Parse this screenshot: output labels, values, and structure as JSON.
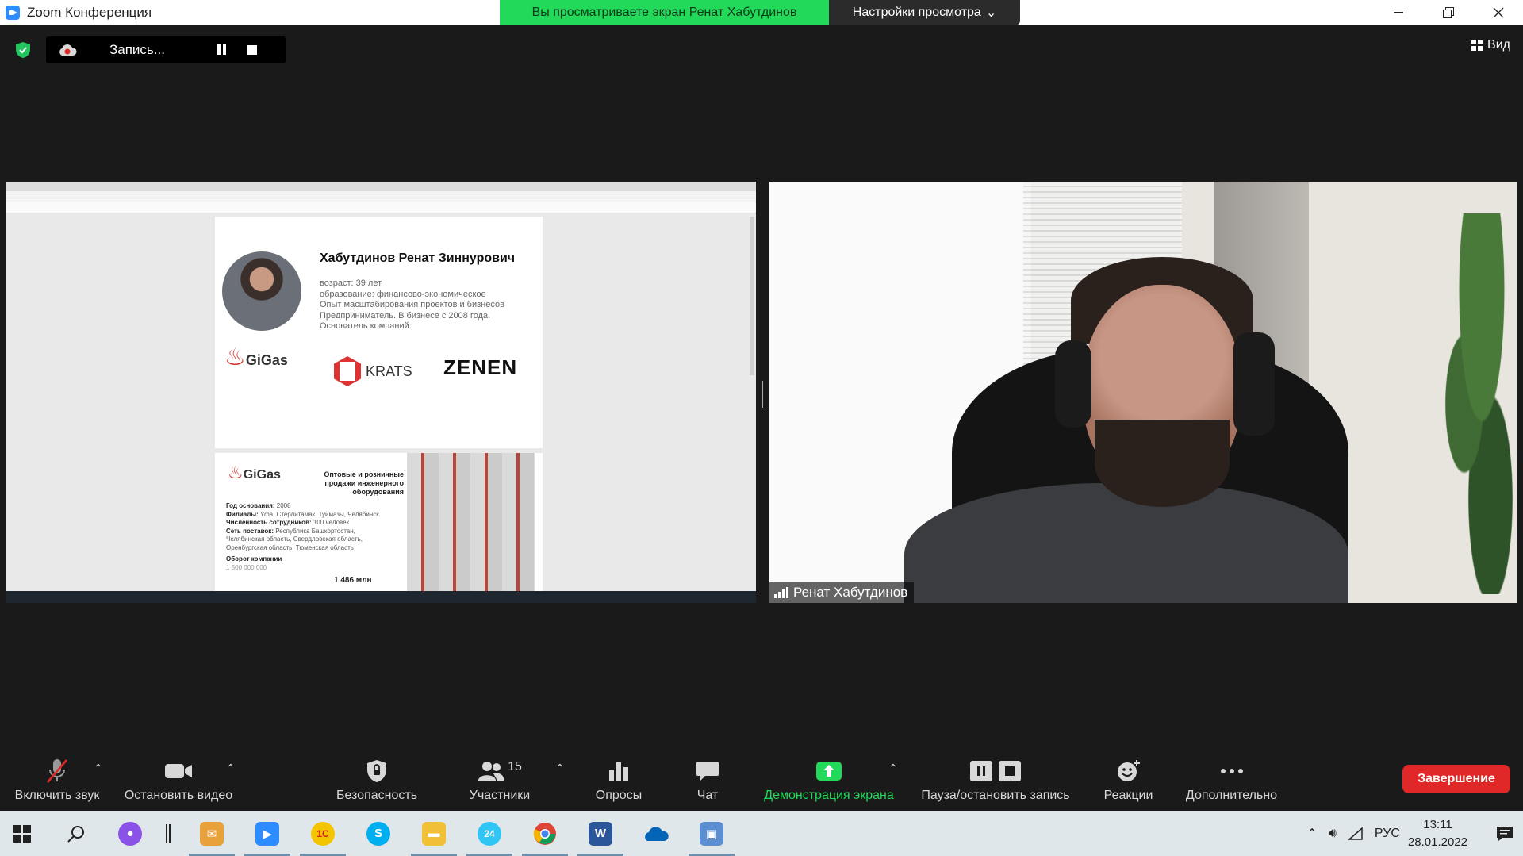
{
  "window": {
    "title": "Zoom Конференция",
    "share_banner": "Вы просматриваете экран Ренат Хабутдинов",
    "view_settings": "Настройки просмотра"
  },
  "recording": {
    "label": "Запись..."
  },
  "view_button": {
    "label": "Вид"
  },
  "shared_screen": {
    "person_name": "Хабутдинов Ренат Зиннурович",
    "person_info": [
      "возраст: 39 лет",
      "образование: финансово-экономическое",
      "Опыт масштабирования проектов и бизнесов",
      "Предприниматель. В бизнесе с 2008 года.",
      "Основатель компаний:"
    ],
    "logos": [
      "GiGas",
      "KRATS",
      "ZENEN"
    ],
    "page2": {
      "logo": "GiGas",
      "heading": "Оптовые и розничные продажи инженерного оборудования",
      "info": [
        {
          "k": "Год основания:",
          "v": "2008"
        },
        {
          "k": "Филиалы:",
          "v": "Уфа, Стерлитамак, Туймазы, Челябинск"
        },
        {
          "k": "Численность сотрудников:",
          "v": "100 человек"
        },
        {
          "k": "Сеть поставок:",
          "v": "Республика Башкортостан, Челябинская область, Свердловская область, Оренбургская область, Тюменская область"
        },
        {
          "k": "Оборот компании",
          "v": ""
        }
      ],
      "turnover_low": "1 500 000 000",
      "turnover_high": "1 486 млн"
    }
  },
  "video": {
    "participant_name": "Ренат Хабутдинов"
  },
  "toolbar": {
    "unmute": "Включить звук",
    "stop_video": "Остановить видео",
    "security": "Безопасность",
    "participants": "Участники",
    "participants_count": "15",
    "polls": "Опросы",
    "chat": "Чат",
    "share_screen": "Демонстрация экрана",
    "pause_record": "Пауза/остановить запись",
    "reactions": "Реакции",
    "more": "Дополнительно",
    "end": "Завершение"
  },
  "taskbar": {
    "apps": [
      "start",
      "search",
      "alice",
      "separator",
      "outlook",
      "zoom",
      "1c",
      "skype",
      "explorer",
      "bitrix24",
      "chrome",
      "word",
      "onedrive",
      "remote-desktop"
    ],
    "active_apps": [
      "outlook",
      "zoom",
      "1c",
      "explorer",
      "bitrix24",
      "chrome",
      "word",
      "remote-desktop"
    ],
    "lang": "РУС",
    "time": "13:11",
    "date": "28.01.2022"
  },
  "colors": {
    "share_green": "#23d959",
    "end_red": "#e02828",
    "muted_red": "#e02828",
    "accent_blue": "#2d8cff"
  }
}
